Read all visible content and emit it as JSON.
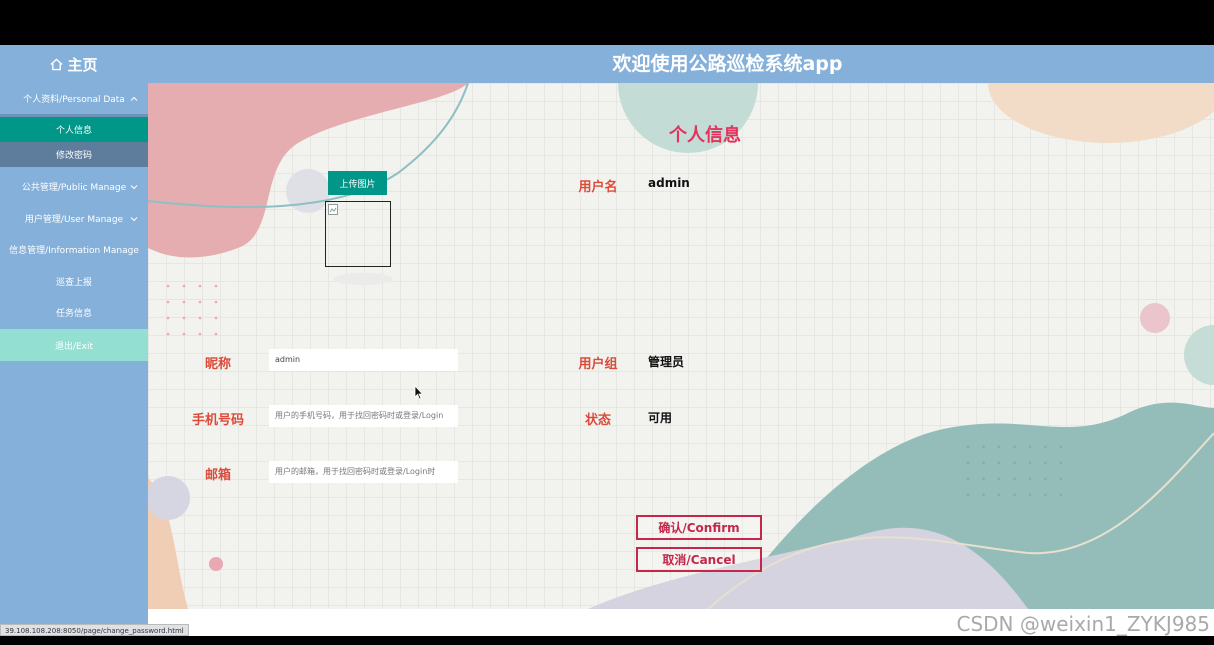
{
  "header": {
    "home_label": "主页",
    "app_title": "欢迎使用公路巡检系统app"
  },
  "sidebar": {
    "groups": [
      {
        "label": "个人资料/Personal Data"
      },
      {
        "label": "公共管理/Public Manage"
      },
      {
        "label": "用户管理/User Manage"
      },
      {
        "label": "信息管理/Information Manage"
      }
    ],
    "sub_personal": [
      {
        "label": "个人信息"
      },
      {
        "label": "修改密码"
      }
    ],
    "sub_info": [
      {
        "label": "巡查上报"
      },
      {
        "label": "任务信息"
      }
    ],
    "exit_label": "退出/Exit"
  },
  "main": {
    "title": "个人信息",
    "upload_button": "上传图片",
    "fields": {
      "username_label": "用户名",
      "username_value": "admin",
      "nickname_label": "昵称",
      "nickname_value": "admin",
      "usergroup_label": "用户组",
      "usergroup_value": "管理员",
      "phone_label": "手机号码",
      "phone_placeholder": "用户的手机号码，用于找回密码时或登录/Login",
      "status_label": "状态",
      "status_value": "可用",
      "email_label": "邮箱",
      "email_placeholder": "用户的邮箱，用于找回密码时或登录/Login时"
    },
    "confirm_button": "确认/Confirm",
    "cancel_button": "取消/Cancel"
  },
  "status_bar_url": "39.108.108.208:8050/page/change_password.html",
  "watermark": "CSDN @weixin1_ZYKJ985",
  "colors": {
    "header": "#85b0da",
    "active_menu": "#009688",
    "accent_title": "#e5315b",
    "label": "#dc4b3a",
    "button_border": "#c5264a"
  }
}
